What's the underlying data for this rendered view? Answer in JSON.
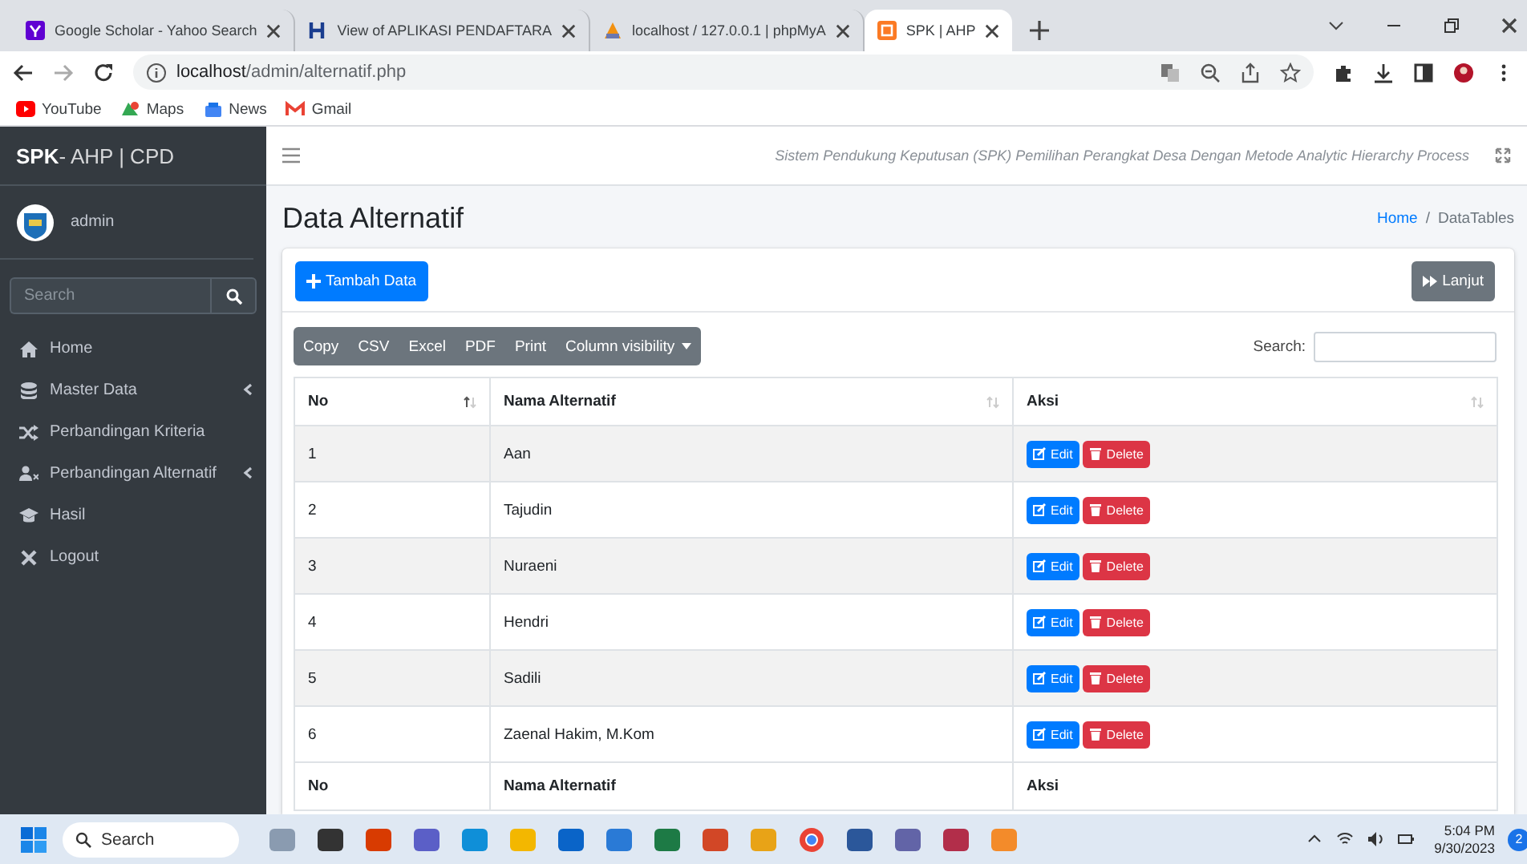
{
  "browser": {
    "tabs": [
      {
        "title": "Google Scholar - Yahoo Search",
        "selected": false
      },
      {
        "title": "View of APLIKASI PENDAFTARA",
        "selected": false
      },
      {
        "title": "localhost / 127.0.0.1 | phpMyA",
        "selected": false
      },
      {
        "title": "SPK | AHP",
        "selected": true
      }
    ],
    "address": {
      "host": "localhost",
      "path": "/admin/alternatif.php"
    },
    "bookmarks": [
      "YouTube",
      "Maps",
      "News",
      "Gmail"
    ]
  },
  "sidebar": {
    "brand": {
      "bold": "SPK",
      "rest": " - AHP | CPD"
    },
    "user": "admin",
    "search": {
      "placeholder": "Search"
    },
    "items": [
      {
        "label": "Home",
        "has_submenu": false
      },
      {
        "label": "Master Data",
        "has_submenu": true
      },
      {
        "label": "Perbandingan Kriteria",
        "has_submenu": false
      },
      {
        "label": "Perbandingan Alternatif",
        "has_submenu": true
      },
      {
        "label": "Hasil",
        "has_submenu": false
      },
      {
        "label": "Logout",
        "has_submenu": false
      }
    ]
  },
  "navbar": {
    "subtitle": "Sistem Pendukung Keputusan (SPK) Pemilihan Perangkat Desa Dengan Metode Analytic Hierarchy Process"
  },
  "page": {
    "title": "Data Alternatif",
    "breadcrumb_separator": "/",
    "breadcrumb": [
      {
        "label": "Home",
        "link": true
      },
      {
        "label": "DataTables",
        "link": false
      }
    ]
  },
  "card": {
    "add_button": "Tambah Data",
    "next_button": "Lanjut",
    "export_buttons": [
      {
        "label": "Copy",
        "dropdown": false
      },
      {
        "label": "CSV",
        "dropdown": false
      },
      {
        "label": "Excel",
        "dropdown": false
      },
      {
        "label": "PDF",
        "dropdown": false
      },
      {
        "label": "Print",
        "dropdown": false
      },
      {
        "label": "Column visibility",
        "dropdown": true
      }
    ],
    "search_label": "Search:",
    "table": {
      "columns": [
        {
          "label": "No",
          "sorted": true
        },
        {
          "label": "Nama Alternatif",
          "sorted": false
        },
        {
          "label": "Aksi",
          "sorted": false
        }
      ],
      "rows": [
        {
          "no": "1",
          "name": "Aan",
          "actions": [
            "Edit",
            "Delete"
          ]
        },
        {
          "no": "2",
          "name": "Tajudin",
          "actions": [
            "Edit",
            "Delete"
          ]
        },
        {
          "no": "3",
          "name": "Nuraeni",
          "actions": [
            "Edit",
            "Delete"
          ]
        },
        {
          "no": "4",
          "name": "Hendri",
          "actions": [
            "Edit",
            "Delete"
          ]
        },
        {
          "no": "5",
          "name": "Sadili",
          "actions": [
            "Edit",
            "Delete"
          ]
        },
        {
          "no": "6",
          "name": "Zaenal Hakim, M.Kom",
          "actions": [
            "Edit",
            "Delete"
          ]
        }
      ],
      "footer": [
        "No",
        "Nama Alternatif",
        "Aksi"
      ]
    }
  },
  "taskbar": {
    "search": {
      "placeholder": "Search"
    },
    "time": "5:04 PM",
    "date": "9/30/2023",
    "notifications": "2"
  }
}
